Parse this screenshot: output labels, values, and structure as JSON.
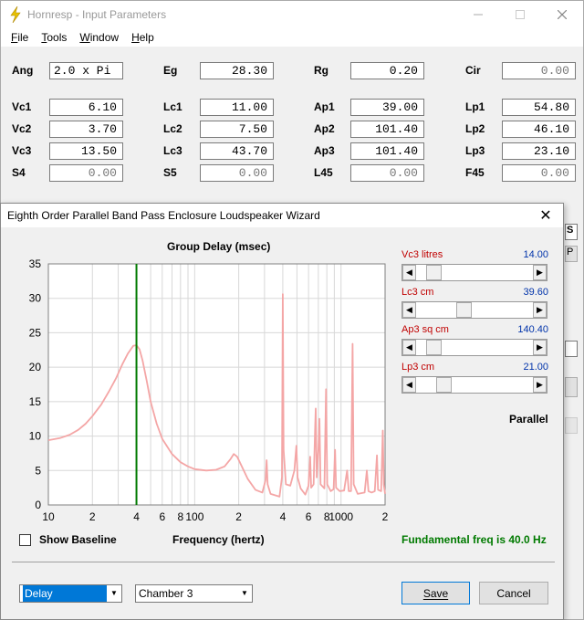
{
  "parent_window": {
    "title": "Hornresp - Input Parameters",
    "menus": [
      {
        "label": "File",
        "accel": "F",
        "rest": "ile"
      },
      {
        "label": "Tools",
        "accel": "T",
        "rest": "ools"
      },
      {
        "label": "Window",
        "accel": "W",
        "rest": "indow"
      },
      {
        "label": "Help",
        "accel": "H",
        "rest": "elp"
      }
    ],
    "params": {
      "ang": {
        "label": "Ang",
        "value": "2.0 x Pi"
      },
      "eg": {
        "label": "Eg",
        "value": "28.30"
      },
      "rg": {
        "label": "Rg",
        "value": "0.20"
      },
      "cir": {
        "label": "Cir",
        "value": "0.00"
      },
      "vc1": {
        "label": "Vc1",
        "value": "6.10"
      },
      "lc1": {
        "label": "Lc1",
        "value": "11.00"
      },
      "ap1": {
        "label": "Ap1",
        "value": "39.00"
      },
      "lp1": {
        "label": "Lp1",
        "value": "54.80"
      },
      "vc2": {
        "label": "Vc2",
        "value": "3.70"
      },
      "lc2": {
        "label": "Lc2",
        "value": "7.50"
      },
      "ap2": {
        "label": "Ap2",
        "value": "101.40"
      },
      "lp2": {
        "label": "Lp2",
        "value": "46.10"
      },
      "vc3": {
        "label": "Vc3",
        "value": "13.50"
      },
      "lc3": {
        "label": "Lc3",
        "value": "43.70"
      },
      "ap3": {
        "label": "Ap3",
        "value": "101.40"
      },
      "lp3": {
        "label": "Lp3",
        "value": "23.10"
      },
      "s4": {
        "label": "S4",
        "value": "0.00"
      },
      "s5": {
        "label": "S5",
        "value": "0.00"
      },
      "l45": {
        "label": "L45",
        "value": "0.00"
      },
      "f45": {
        "label": "F45",
        "value": "0.00"
      }
    },
    "peek_chars": {
      "s": "S",
      "p": "P"
    }
  },
  "wizard": {
    "title": "Eighth Order Parallel Band Pass Enclosure Loudspeaker Wizard",
    "close_glyph": "✕",
    "sliders": [
      {
        "label": "Vc3  litres",
        "value": "14.00",
        "position": 0.1
      },
      {
        "label": "Lc3  cm",
        "value": "39.60",
        "position": 0.4
      },
      {
        "label": "Ap3  sq cm",
        "value": "140.40",
        "position": 0.1
      },
      {
        "label": "Lp3  cm",
        "value": "21.00",
        "position": 0.2
      }
    ],
    "mode_label": "Parallel",
    "show_baseline": {
      "label": "Show Baseline",
      "checked": false
    },
    "fundamental": "Fundamental freq is 40.0 Hz",
    "view_select": "Delay",
    "chamber_select": "Chamber 3",
    "save_label": "Save",
    "cancel_label": "Cancel"
  },
  "chart_data": {
    "type": "line",
    "title": "Group Delay (msec)",
    "xlabel": "Frequency (hertz)",
    "ylabel": "",
    "x_scale": "log",
    "xlim": [
      10,
      2000
    ],
    "ylim": [
      0,
      35
    ],
    "y_ticks": [
      0,
      5,
      10,
      15,
      20,
      25,
      30,
      35
    ],
    "x_tick_labels": [
      {
        "value": 10,
        "label": "10"
      },
      {
        "value": 20,
        "label": "2"
      },
      {
        "value": 40,
        "label": "4"
      },
      {
        "value": 60,
        "label": "6"
      },
      {
        "value": 80,
        "label": "8"
      },
      {
        "value": 100,
        "label": "100"
      },
      {
        "value": 200,
        "label": "2"
      },
      {
        "value": 400,
        "label": "4"
      },
      {
        "value": 600,
        "label": "6"
      },
      {
        "value": 800,
        "label": "8"
      },
      {
        "value": 1000,
        "label": "1000"
      },
      {
        "value": 2000,
        "label": "2"
      }
    ],
    "grid": true,
    "marker_frequency": 40,
    "series_color": "#f4a6a6",
    "marker_color": "#007a00",
    "series": [
      {
        "points": [
          [
            10,
            9.4
          ],
          [
            12,
            9.7
          ],
          [
            14,
            10.2
          ],
          [
            16,
            10.9
          ],
          [
            18,
            11.8
          ],
          [
            20,
            12.9
          ],
          [
            23,
            14.6
          ],
          [
            26,
            16.5
          ],
          [
            29,
            18.4
          ],
          [
            32,
            20.4
          ],
          [
            35,
            22.0
          ],
          [
            38,
            23.1
          ],
          [
            40,
            23.2
          ],
          [
            42,
            22.6
          ],
          [
            44,
            21.0
          ],
          [
            47,
            18.0
          ],
          [
            50,
            15.0
          ],
          [
            55,
            11.8
          ],
          [
            60,
            9.6
          ],
          [
            70,
            7.4
          ],
          [
            80,
            6.2
          ],
          [
            90,
            5.6
          ],
          [
            100,
            5.2
          ],
          [
            120,
            5.0
          ],
          [
            140,
            5.1
          ],
          [
            160,
            5.6
          ],
          [
            175,
            6.6
          ],
          [
            185,
            7.4
          ],
          [
            195,
            7.0
          ],
          [
            210,
            5.6
          ],
          [
            230,
            3.8
          ],
          [
            260,
            2.2
          ],
          [
            290,
            1.8
          ],
          [
            305,
            3.6
          ],
          [
            310,
            6.5
          ],
          [
            315,
            3.0
          ],
          [
            330,
            1.6
          ],
          [
            380,
            1.2
          ],
          [
            395,
            4.0
          ],
          [
            400,
            30.6
          ],
          [
            405,
            8.0
          ],
          [
            420,
            3.0
          ],
          [
            450,
            2.8
          ],
          [
            480,
            5.0
          ],
          [
            495,
            8.6
          ],
          [
            505,
            4.0
          ],
          [
            530,
            2.4
          ],
          [
            570,
            1.5
          ],
          [
            600,
            2.8
          ],
          [
            615,
            7.0
          ],
          [
            625,
            2.5
          ],
          [
            650,
            3.0
          ],
          [
            665,
            11.0
          ],
          [
            672,
            14.0
          ],
          [
            682,
            4.0
          ],
          [
            700,
            8.0
          ],
          [
            712,
            12.5
          ],
          [
            725,
            3.0
          ],
          [
            770,
            2.4
          ],
          [
            790,
            16.8
          ],
          [
            805,
            3.0
          ],
          [
            850,
            2.0
          ],
          [
            890,
            2.3
          ],
          [
            910,
            8.0
          ],
          [
            925,
            2.5
          ],
          [
            980,
            2.0
          ],
          [
            1050,
            2.1
          ],
          [
            1100,
            5.0
          ],
          [
            1130,
            2.0
          ],
          [
            1170,
            2.0
          ],
          [
            1200,
            23.4
          ],
          [
            1220,
            3.0
          ],
          [
            1300,
            1.6
          ],
          [
            1450,
            1.8
          ],
          [
            1500,
            5.0
          ],
          [
            1540,
            2.0
          ],
          [
            1620,
            1.8
          ],
          [
            1700,
            2.0
          ],
          [
            1760,
            7.2
          ],
          [
            1790,
            2.2
          ],
          [
            1880,
            2.0
          ],
          [
            1930,
            10.8
          ],
          [
            1960,
            3.0
          ],
          [
            2000,
            1.6
          ]
        ]
      }
    ]
  }
}
